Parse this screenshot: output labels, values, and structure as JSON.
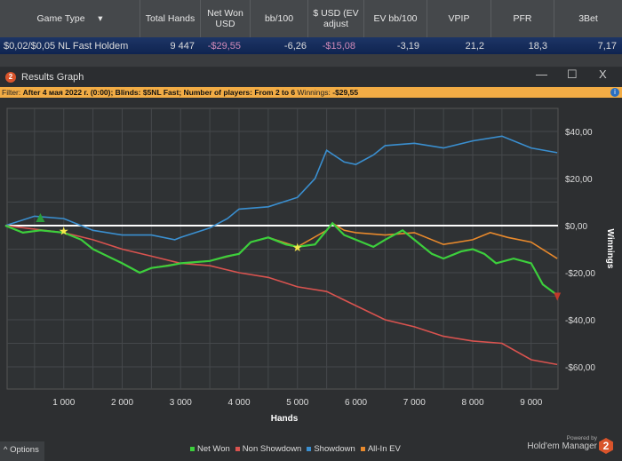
{
  "table": {
    "headers": [
      "Game Type",
      "Total Hands",
      "Net Won USD",
      "bb/100",
      "$ USD (EV adjust",
      "EV bb/100",
      "VPIP",
      "PFR",
      "3Bet"
    ],
    "row": [
      "$0,02/$0,05 NL Fast Holdem",
      "9 447",
      "-$29,55",
      "-6,26",
      "-$15,08",
      "-3,19",
      "21,2",
      "18,3",
      "7,17"
    ]
  },
  "window": {
    "badge": "2",
    "title": "Results Graph",
    "minimize": "—",
    "maximize": "☐",
    "close": "X"
  },
  "filter": {
    "label": "Filter:",
    "text": "After 4 мая 2022 г. (0:00); Blinds: $5NL Fast; Number of players: From 2 to 6",
    "winnings_label": "Winnings:",
    "winnings": "-$29,55",
    "info": "i"
  },
  "chart_data": {
    "type": "line",
    "xlabel": "Hands",
    "ylabel": "Winnings",
    "xlim": [
      0,
      9447
    ],
    "ylim": [
      -68,
      52
    ],
    "xticks": [
      1000,
      2000,
      3000,
      4000,
      5000,
      6000,
      7000,
      8000,
      9000
    ],
    "xtick_labels": [
      "1 000",
      "2 000",
      "3 000",
      "4 000",
      "5 000",
      "6 000",
      "7 000",
      "8 000",
      "9 000"
    ],
    "yticks": [
      40,
      20,
      0,
      -20,
      -40,
      -60
    ],
    "ytick_labels": [
      "$40,00",
      "$20,00",
      "$0,00",
      "-$20,00",
      "-$40,00",
      "-$60,00"
    ],
    "series": [
      {
        "name": "Showdown",
        "color": "#3a8fd0",
        "x": [
          0,
          500,
          1000,
          1500,
          2000,
          2500,
          2900,
          3000,
          3500,
          3800,
          4000,
          4500,
          5000,
          5300,
          5500,
          5800,
          6000,
          6300,
          6500,
          7000,
          7500,
          8000,
          8500,
          9000,
          9447
        ],
        "y": [
          0,
          4,
          3,
          -2,
          -4,
          -4,
          -6,
          -5,
          -1,
          3,
          7,
          8,
          12,
          20,
          32,
          27,
          26,
          30,
          34,
          35,
          33,
          36,
          38,
          33,
          31
        ]
      },
      {
        "name": "Non Showdown",
        "color": "#d9534f",
        "x": [
          0,
          1000,
          1500,
          2000,
          2500,
          3000,
          3500,
          4000,
          4500,
          5000,
          5500,
          6000,
          6500,
          7000,
          7500,
          8000,
          8500,
          9000,
          9447
        ],
        "y": [
          0,
          -3,
          -6,
          -10,
          -13,
          -16,
          -17,
          -20,
          -22,
          -26,
          -28,
          -34,
          -40,
          -43,
          -47,
          -49,
          -50,
          -57,
          -59
        ]
      },
      {
        "name": "All-In EV",
        "color": "#e8892c",
        "x": [
          0,
          300,
          600,
          1000,
          1300,
          1500,
          2000,
          2300,
          2500,
          3000,
          3500,
          4000,
          4200,
          4500,
          5000,
          5500,
          5600,
          5800,
          6000,
          6500,
          7000,
          7500,
          8000,
          8300,
          8600,
          9000,
          9447
        ],
        "y": [
          0,
          -3,
          -2,
          -3,
          -6,
          -10,
          -16,
          -20,
          -18,
          -16,
          -15,
          -12,
          -7,
          -5,
          -9,
          -2,
          1,
          -2,
          -3,
          -4,
          -3,
          -8,
          -6,
          -3,
          -5,
          -7,
          -14
        ]
      },
      {
        "name": "Net Won",
        "color": "#3ccf3c",
        "x": [
          0,
          300,
          600,
          1000,
          1300,
          1500,
          2000,
          2300,
          2500,
          2800,
          3000,
          3500,
          3800,
          4000,
          4200,
          4500,
          4800,
          5000,
          5300,
          5500,
          5600,
          5800,
          6000,
          6300,
          6500,
          6800,
          7000,
          7300,
          7500,
          7800,
          8000,
          8200,
          8400,
          8700,
          9000,
          9200,
          9447
        ],
        "y": [
          0,
          -3,
          -2,
          -3,
          -6,
          -10,
          -16,
          -20,
          -18,
          -17,
          -16,
          -15,
          -13,
          -12,
          -7,
          -5,
          -8,
          -9,
          -8,
          -2,
          1,
          -4,
          -6,
          -9,
          -6,
          -2,
          -6,
          -12,
          -14,
          -11,
          -10,
          -12,
          -16,
          -14,
          -16,
          -25,
          -29.5
        ]
      }
    ],
    "markers": [
      {
        "type": "star",
        "x": 1000,
        "y": -2
      },
      {
        "type": "star",
        "x": 5000,
        "y": -9
      }
    ]
  },
  "legend": [
    "Net Won",
    "Non Showdown",
    "Showdown",
    "All-In EV"
  ],
  "footer": {
    "options": "^  Options",
    "powered_by": "Powered by",
    "brand": "Hold'em Manager",
    "brand_badge": "2"
  }
}
